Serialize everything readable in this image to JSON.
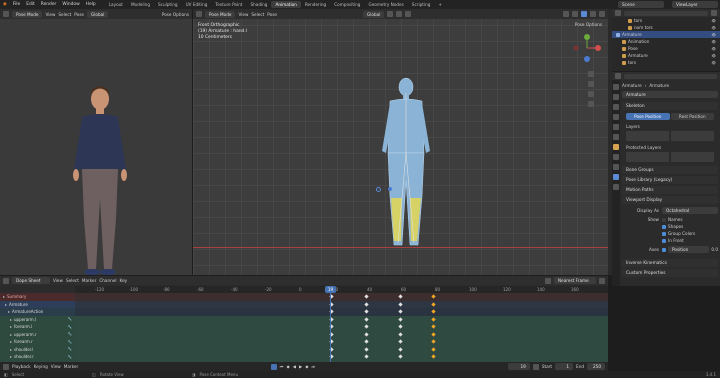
{
  "menubar": {
    "items": [
      "File",
      "Edit",
      "Render",
      "Window",
      "Help"
    ],
    "workspaces": [
      "Layout",
      "Modeling",
      "Sculpting",
      "UV Editing",
      "Texture Paint",
      "Shading",
      "Animation",
      "Rendering",
      "Compositing",
      "Geometry Nodes",
      "Scripting"
    ],
    "active_workspace": "Animation",
    "scene": "Scene",
    "view_layer": "ViewLayer"
  },
  "left_viewport": {
    "mode": "Pose Mode",
    "view_menu": [
      "View",
      "Select",
      "Pose"
    ],
    "transform": "Global",
    "options": "Pose Options"
  },
  "main_viewport": {
    "mode": "Pose Mode",
    "view_menu": [
      "View",
      "Select",
      "Pose"
    ],
    "transform": "Global",
    "options": "Pose Options",
    "overlay_title": "Front Orthographic",
    "overlay_object": "(19) Armature : hand.l",
    "overlay_units": "10 Centimeters"
  },
  "outliner": {
    "rows": [
      {
        "label": "tors",
        "indent": 2
      },
      {
        "label": "nom tors",
        "indent": 2
      },
      {
        "label": "Armature",
        "indent": 0,
        "selected": true
      },
      {
        "label": "Animation",
        "indent": 1
      },
      {
        "label": "Pose",
        "indent": 1
      },
      {
        "label": "Armature",
        "indent": 1
      },
      {
        "label": "tors",
        "indent": 1
      }
    ]
  },
  "properties": {
    "breadcrumb": [
      "Armature",
      "Armature"
    ],
    "name_field": "Armature",
    "skeleton_label": "Skeleton",
    "pose_position": "Pose Position",
    "rest_position": "Rest Position",
    "layers_label": "Layers",
    "protected_layers_label": "Protected Layers",
    "sections": [
      "Bone Groups",
      "Pose Library (Legacy)",
      "Motion Paths",
      "Viewport Display"
    ],
    "display_as_label": "Display As",
    "display_as_value": "Octahedral",
    "show_label": "Show",
    "show_options": [
      "Names",
      "Shapes",
      "Group Colors",
      "In Front"
    ],
    "axes_label": "Axes",
    "axes_value": "Position",
    "axes_num": "0.0",
    "bottom_sections": [
      "Inverse Kinematics",
      "Custom Properties"
    ]
  },
  "dopesheet": {
    "mode": "Dope Sheet",
    "menu": [
      "View",
      "Select",
      "Marker",
      "Channel",
      "Key"
    ],
    "snapping": "Nearest Frame",
    "ticks": [
      "-120",
      "-100",
      "-80",
      "-60",
      "-40",
      "-20",
      "0",
      "20",
      "40",
      "60",
      "80",
      "100",
      "120",
      "140",
      "160"
    ],
    "current_frame": "19",
    "channels": [
      {
        "label": "Summary",
        "type": "summary"
      },
      {
        "label": "Armature",
        "type": "object"
      },
      {
        "label": "ArmatureAction",
        "type": "action"
      },
      {
        "label": "upperarm.l",
        "type": "group"
      },
      {
        "label": "forearm.l",
        "type": "group"
      },
      {
        "label": "upperarm.r",
        "type": "group"
      },
      {
        "label": "forearm.r",
        "type": "group"
      },
      {
        "label": "shoulder.l",
        "type": "group"
      },
      {
        "label": "shoulder.r",
        "type": "group"
      },
      {
        "label": "hand.l",
        "type": "group"
      }
    ]
  },
  "playbar": {
    "items": [
      "Playback",
      "Keying",
      "View",
      "Marker"
    ],
    "frame": "19",
    "start_label": "Start",
    "start": "1",
    "end_label": "End",
    "end": "250"
  },
  "statusbar": {
    "left": "Select",
    "mid": "Rotate View",
    "right": "Pose Context Menu",
    "version": "3.4.1"
  },
  "colors": {
    "accent": "#4772b3",
    "frame_indicator": "#4772b3",
    "keyframe_selected": "#f5a623"
  }
}
